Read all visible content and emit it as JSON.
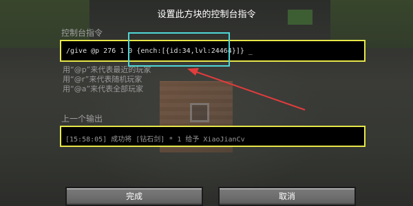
{
  "dialog": {
    "title": "设置此方块的控制台指令",
    "command_label": "控制台指令",
    "command_value": "/give @p 276 1 0 {ench:[{id:34,lvl:24464}]} _",
    "hints": [
      "用“@p”来代表最近的玩家",
      "用“@r”来代表随机玩家",
      "用“@a”来代表全部玩家"
    ],
    "previous_output_label": "上一个输出",
    "previous_output_value": "[15:58:05] 成功将 [钻石剑] * 1 给予 XiaoJianCv",
    "done_label": "完成",
    "cancel_label": "取消"
  },
  "colors": {
    "field_border": "#e8e84a",
    "highlight_box": "#4fd8d8",
    "annotation_arrow": "#e23c3c"
  }
}
